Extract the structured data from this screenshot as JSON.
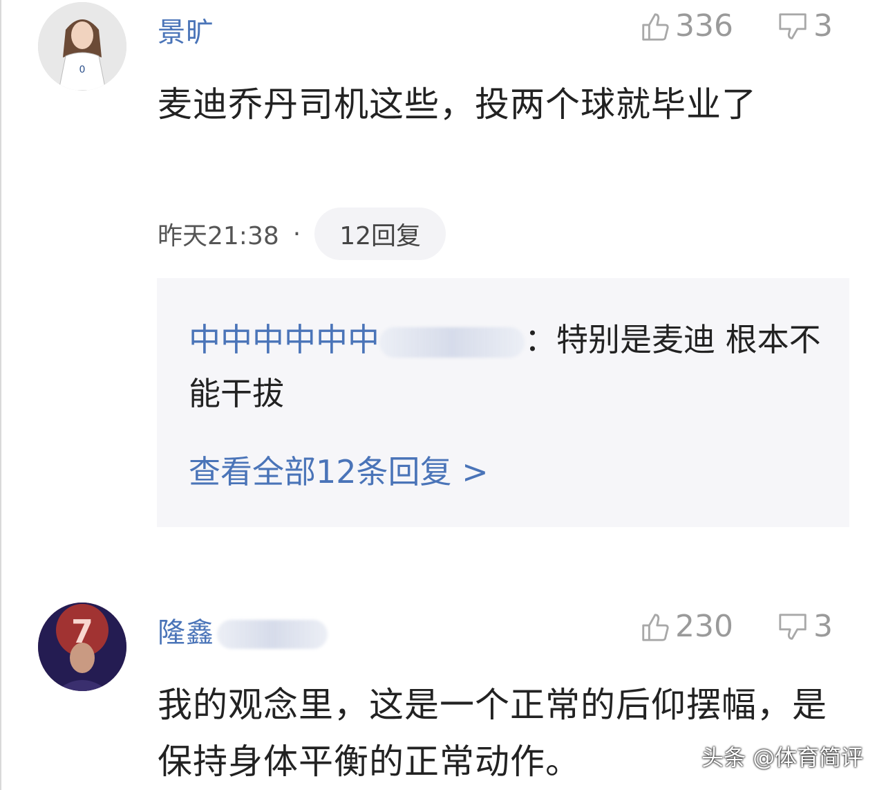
{
  "comments": [
    {
      "username": "景旷",
      "likes": "336",
      "dislikes": "3",
      "text": "麦迪乔丹司机这些，投两个球就毕业了",
      "time": "昨天21:38",
      "dot": "·",
      "reply_count": "12回复",
      "reply_preview": {
        "author": "中中中中中中",
        "colon": "：",
        "text": "特别是麦迪 根本不能干拔"
      },
      "view_all": "查看全部12条回复 >"
    },
    {
      "username": "隆鑫",
      "likes": "230",
      "dislikes": "3",
      "text": "我的观念里，这是一个正常的后仰摆幅，是保持身体平衡的正常动作。"
    }
  ],
  "watermark": "头条 @体育简评",
  "colors": {
    "link_blue": "#4a74b8",
    "stat_gray": "#9a9a9a",
    "reply_bg": "#f6f6f9"
  },
  "icons": [
    "thumbs-up-icon",
    "thumbs-down-icon"
  ]
}
